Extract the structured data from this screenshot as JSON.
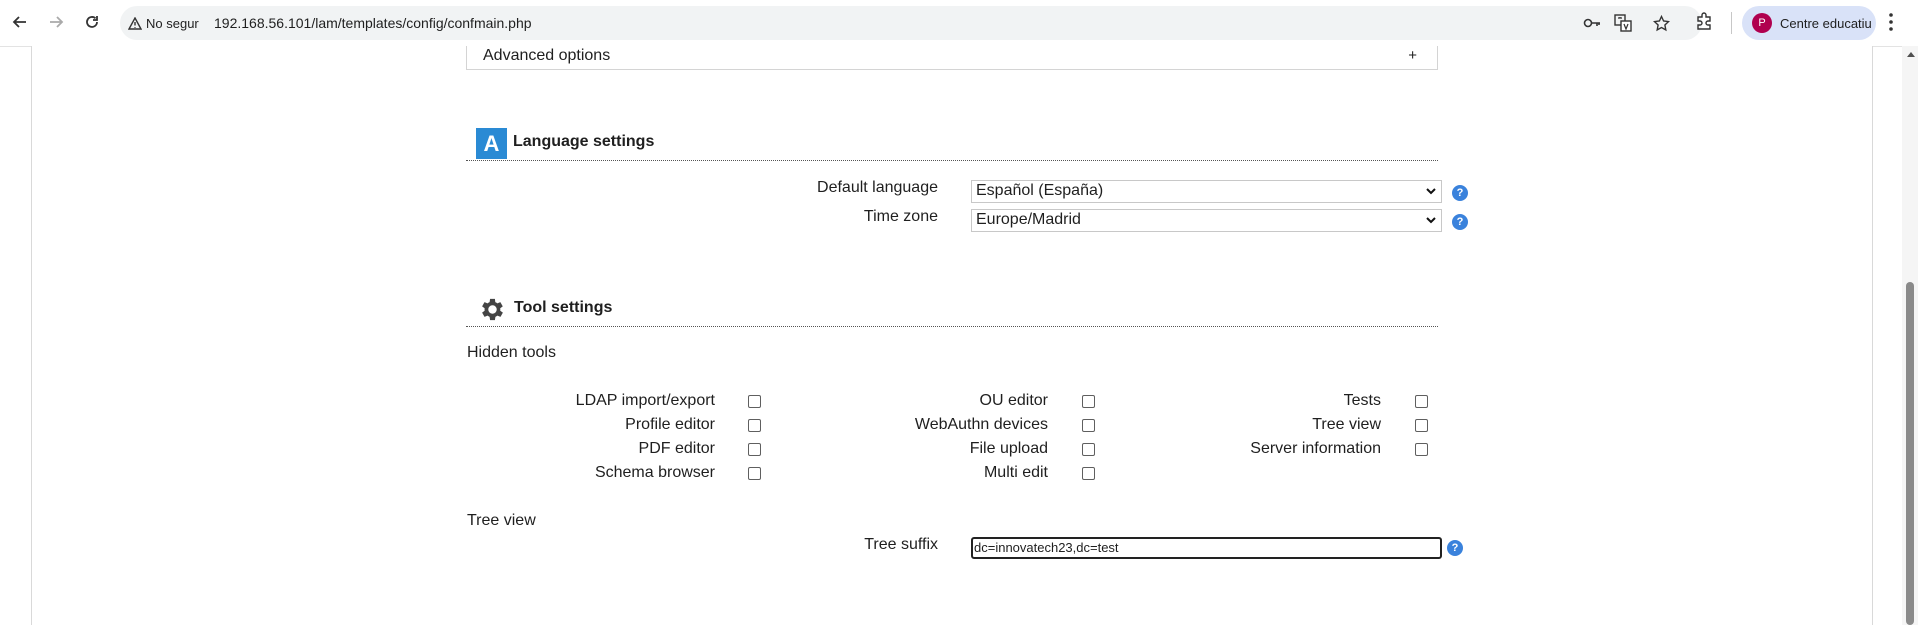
{
  "browser": {
    "security_label": "No segur",
    "url": "192.168.56.101/lam/templates/config/confmain.php",
    "profile_initial": "P",
    "profile_name": "Centre educatiu"
  },
  "advanced": {
    "label": "Advanced options",
    "toggle": "+"
  },
  "language": {
    "icon_letter": "A",
    "title": "Language settings",
    "default_language_label": "Default language",
    "default_language_value": "Español (España)",
    "time_zone_label": "Time zone",
    "time_zone_value": "Europe/Madrid",
    "help": "?"
  },
  "tools": {
    "title": "Tool settings",
    "hidden_tools_label": "Hidden tools",
    "col1": [
      "LDAP import/export",
      "Profile editor",
      "PDF editor",
      "Schema browser"
    ],
    "col2": [
      "OU editor",
      "WebAuthn devices",
      "File upload",
      "Multi edit"
    ],
    "col3": [
      "Tests",
      "Tree view",
      "Server information"
    ],
    "tree_view_heading": "Tree view",
    "tree_suffix_label": "Tree suffix",
    "tree_suffix_value": "dc=innovatech23,dc=test",
    "help": "?"
  },
  "colors": {
    "accent": "#2a8ad4",
    "help": "#3a82dc",
    "profile_bg": "#d9e2f8",
    "avatar": "#b0004f"
  }
}
